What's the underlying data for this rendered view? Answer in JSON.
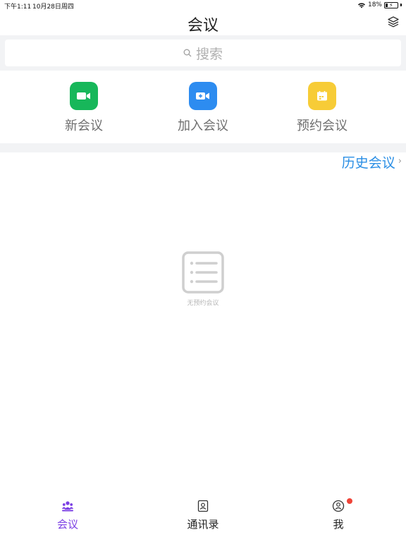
{
  "status_bar": {
    "time": "下午1:11",
    "date": "10月28日周四",
    "battery": "18%"
  },
  "nav": {
    "title": "会议"
  },
  "search": {
    "placeholder": "搜索"
  },
  "actions": [
    {
      "label": "新会议",
      "color": "#17b75a",
      "icon": "video-camera-icon"
    },
    {
      "label": "加入会议",
      "color": "#2d8cf0",
      "icon": "video-plus-icon"
    },
    {
      "label": "预约会议",
      "color": "#f7cc37",
      "icon": "calendar-icon"
    }
  ],
  "history": {
    "label": "历史会议"
  },
  "empty_state": {
    "text": "无预约会议"
  },
  "tabs": [
    {
      "label": "会议",
      "icon": "meeting-group-icon",
      "active": true
    },
    {
      "label": "通讯录",
      "icon": "contacts-icon",
      "active": false
    },
    {
      "label": "我",
      "icon": "profile-icon",
      "active": false,
      "badge": true
    }
  ],
  "colors": {
    "accent": "#7b3fe4",
    "link": "#2b8fe5",
    "background_gray": "#f2f3f5",
    "badge": "#ef4438"
  }
}
